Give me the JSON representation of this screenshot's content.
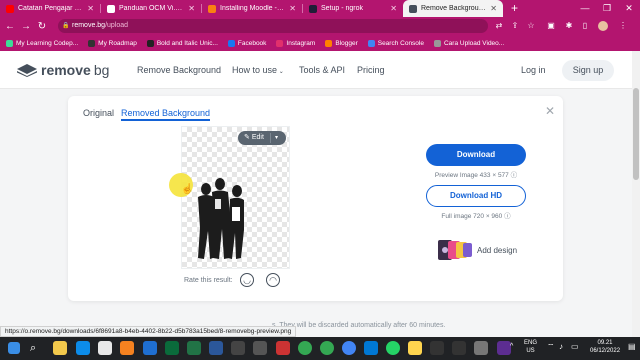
{
  "browser": {
    "tabs": [
      {
        "title": "Catatan Pengajar Praktik",
        "color": "#ff0000",
        "active": false
      },
      {
        "title": "Panduan OCM Vi.pdf",
        "color": "#ffffff",
        "active": false
      },
      {
        "title": "Installing Moodle - Mood",
        "color": "#f98012",
        "active": false
      },
      {
        "title": "Setup - ngrok",
        "color": "#1f1e37",
        "active": false
      },
      {
        "title": "Remove Background from",
        "color": "#454f5b",
        "active": true
      }
    ],
    "new_tab": "+",
    "url_host": "remove.bg",
    "url_path": "/upload",
    "bookmarks": [
      {
        "label": "My Learning Codep...",
        "color": "#3ddc97"
      },
      {
        "label": "My Roadmap",
        "color": "#333333"
      },
      {
        "label": "Bold and Italic Unic...",
        "color": "#222222"
      },
      {
        "label": "Facebook",
        "color": "#1877f2"
      },
      {
        "label": "Instagram",
        "color": "#e1306c"
      },
      {
        "label": "Blogger",
        "color": "#ff8000"
      },
      {
        "label": "Search Console",
        "color": "#4285f4"
      },
      {
        "label": "Cara Upload Video...",
        "color": "#999999"
      }
    ]
  },
  "site": {
    "logo_bold": "remove",
    "logo_light": "bg",
    "nav": [
      "Remove Background",
      "How to use",
      "Tools & API",
      "Pricing"
    ],
    "login": "Log in",
    "signup": "Sign up"
  },
  "result": {
    "tab_original": "Original",
    "tab_removed": "Removed Background",
    "edit": "Edit",
    "rate": "Rate this result:",
    "download": "Download",
    "preview_info": "Preview Image 433 × 577",
    "download_hd": "Download HD",
    "full_info": "Full image 720 × 960",
    "add_design": "Add design"
  },
  "footnote": "s. They will be discarded automatically after 60 minutes.",
  "status_url": "https://o.remove.bg/downloads/6f8691a8-b4eb-4402-8b22-d5b783a15bed/8-removebg-preview.png",
  "taskbar": {
    "lang_line1": "ENG",
    "lang_line2": "US",
    "time": "09.21",
    "date": "06/12/2022"
  },
  "colors": {
    "chrome": "#b3156f",
    "accent": "#1362d6"
  }
}
